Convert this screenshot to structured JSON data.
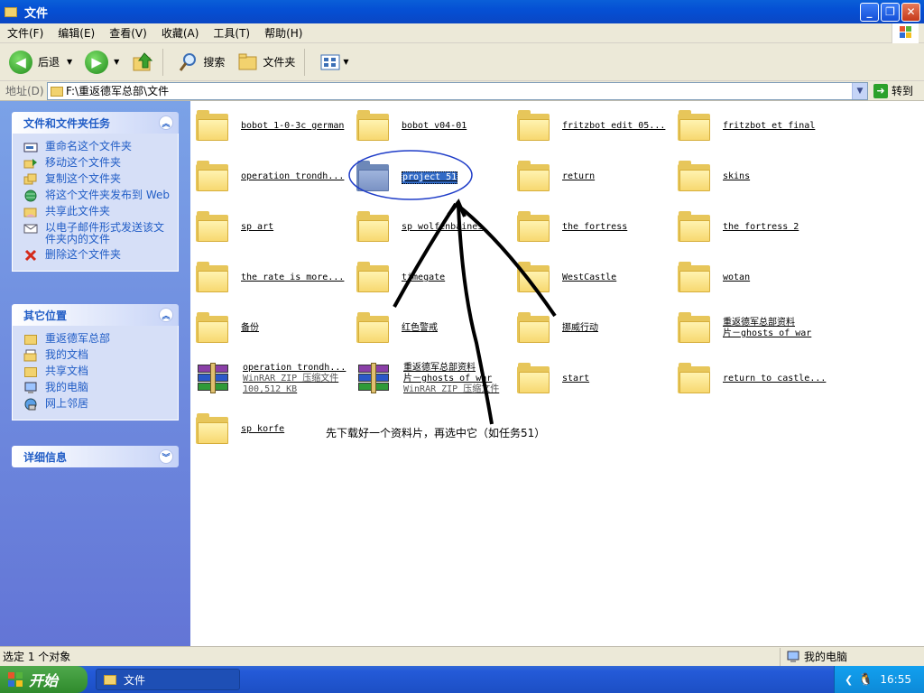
{
  "window": {
    "title": "文件"
  },
  "menu": [
    "文件(F)",
    "编辑(E)",
    "查看(V)",
    "收藏(A)",
    "工具(T)",
    "帮助(H)"
  ],
  "toolbar": {
    "back": "后退",
    "search": "搜索",
    "folders": "文件夹"
  },
  "address": {
    "label": "地址(D)",
    "value": "F:\\重返德军总部\\文件",
    "go": "转到"
  },
  "sidebar": {
    "tasks": {
      "title": "文件和文件夹任务",
      "items": [
        "重命名这个文件夹",
        "移动这个文件夹",
        "复制这个文件夹",
        "将这个文件夹发布到 Web",
        "共享此文件夹",
        "以电子邮件形式发送该文件夹内的文件",
        "删除这个文件夹"
      ]
    },
    "places": {
      "title": "其它位置",
      "items": [
        "重返德军总部",
        "我的文档",
        "共享文档",
        "我的电脑",
        "网上邻居"
      ]
    },
    "details": {
      "title": "详细信息"
    }
  },
  "files": [
    {
      "name": "bobot 1-0-3c german",
      "type": "folder"
    },
    {
      "name": "bobot v04-01",
      "type": "folder"
    },
    {
      "name": "fritzbot edit 05...",
      "type": "folder"
    },
    {
      "name": "fritzbot et final",
      "type": "folder"
    },
    {
      "name": "operation trondh...",
      "type": "folder"
    },
    {
      "name": "project 51",
      "type": "folder",
      "selected": true
    },
    {
      "name": "return",
      "type": "folder"
    },
    {
      "name": "skins",
      "type": "folder"
    },
    {
      "name": "sp art",
      "type": "folder"
    },
    {
      "name": "sp wolfenbaines",
      "type": "folder"
    },
    {
      "name": "the fortress",
      "type": "folder"
    },
    {
      "name": "the fortress 2",
      "type": "folder"
    },
    {
      "name": "the rate is more...",
      "type": "folder"
    },
    {
      "name": "timegate",
      "type": "folder"
    },
    {
      "name": "WestCastle",
      "type": "folder"
    },
    {
      "name": "wotan",
      "type": "folder"
    },
    {
      "name": "备份",
      "type": "folder"
    },
    {
      "name": "红色警戒",
      "type": "folder"
    },
    {
      "name": "挪威行动",
      "type": "folder"
    },
    {
      "name": "重返德军总部资料片－ghosts of war",
      "line1": "重返德军总部资料",
      "line2": "片－ghosts of war",
      "type": "folder"
    },
    {
      "name": "operation trondh...",
      "type": "rar",
      "sub1": "WinRAR ZIP 压缩文件",
      "sub2": "100,512 KB"
    },
    {
      "name": "重返德军总部资料片－ghosts of war",
      "line1": "重返德军总部资料",
      "line2": "片－ghosts of war",
      "type": "rar",
      "sub1": "WinRAR ZIP 压缩文件"
    },
    {
      "name": "start",
      "type": "folder"
    },
    {
      "name": "return to castle...",
      "type": "folder"
    },
    {
      "name": "sp korfe",
      "type": "folder"
    }
  ],
  "annotation": "先下载好一个资料片，再选中它（如任务51）",
  "status": {
    "left": "选定 1 个对象",
    "right": "我的电脑"
  },
  "taskbar": {
    "start": "开始",
    "task": "文件",
    "clock": "16:55"
  }
}
